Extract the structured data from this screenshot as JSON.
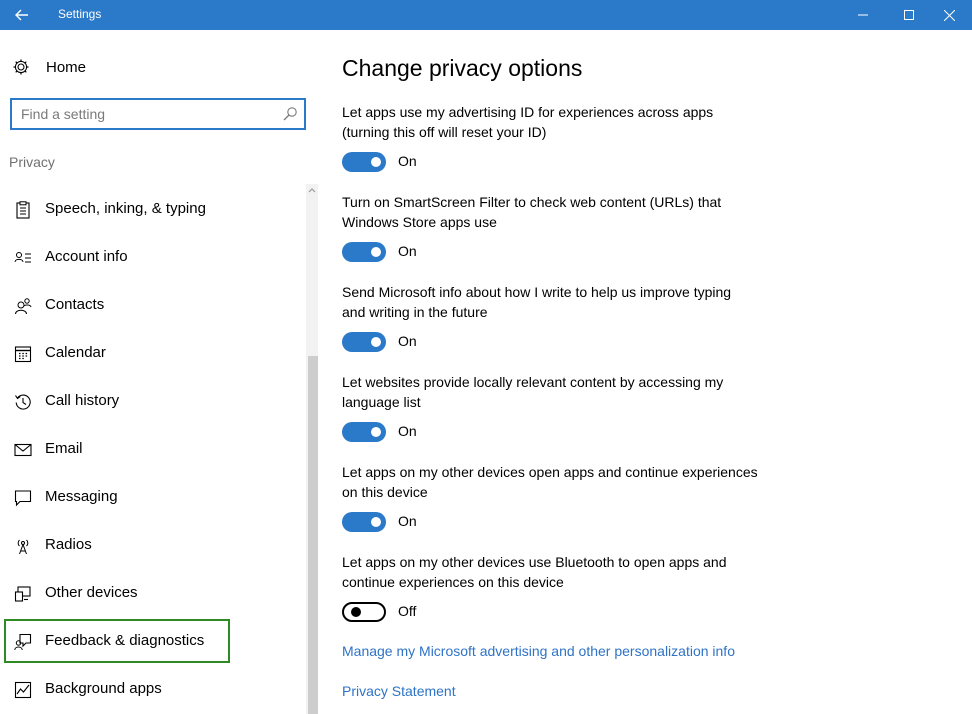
{
  "window": {
    "title": "Settings"
  },
  "sidebar": {
    "home_label": "Home",
    "search_placeholder": "Find a setting",
    "section_label": "Privacy",
    "items": [
      {
        "label": "Speech, inking, & typing",
        "icon": "speech-icon"
      },
      {
        "label": "Account info",
        "icon": "account-info-icon"
      },
      {
        "label": "Contacts",
        "icon": "contacts-icon"
      },
      {
        "label": "Calendar",
        "icon": "calendar-icon"
      },
      {
        "label": "Call history",
        "icon": "call-history-icon"
      },
      {
        "label": "Email",
        "icon": "email-icon"
      },
      {
        "label": "Messaging",
        "icon": "messaging-icon"
      },
      {
        "label": "Radios",
        "icon": "radios-icon"
      },
      {
        "label": "Other devices",
        "icon": "other-devices-icon"
      },
      {
        "label": "Feedback & diagnostics",
        "icon": "feedback-icon",
        "selected": true
      },
      {
        "label": "Background apps",
        "icon": "background-apps-icon"
      }
    ]
  },
  "main": {
    "heading": "Change privacy options",
    "settings": [
      {
        "line1": "Let apps use my advertising ID for experiences across apps",
        "line2": "(turning this off will reset your ID)",
        "state": "On",
        "on": true
      },
      {
        "line1": "Turn on SmartScreen Filter to check web content (URLs) that",
        "line2": "Windows Store apps use",
        "state": "On",
        "on": true
      },
      {
        "line1": "Send Microsoft info about how I write to help us improve typing",
        "line2": "and writing in the future",
        "state": "On",
        "on": true
      },
      {
        "line1": "Let websites provide locally relevant content by accessing my",
        "line2": "language list",
        "state": "On",
        "on": true
      },
      {
        "line1": "Let apps on my other devices open apps and continue experiences",
        "line2": "on this device",
        "state": "On",
        "on": true
      },
      {
        "line1": "Let apps on my other devices use Bluetooth to open apps and",
        "line2": "continue experiences on this device",
        "state": "Off",
        "on": false
      }
    ],
    "links": {
      "manage": "Manage my Microsoft advertising and other personalization info",
      "privacy": "Privacy Statement"
    }
  },
  "colors": {
    "accent": "#2b79c9",
    "selected_border": "#2e8b23",
    "link": "#2e73c6"
  }
}
